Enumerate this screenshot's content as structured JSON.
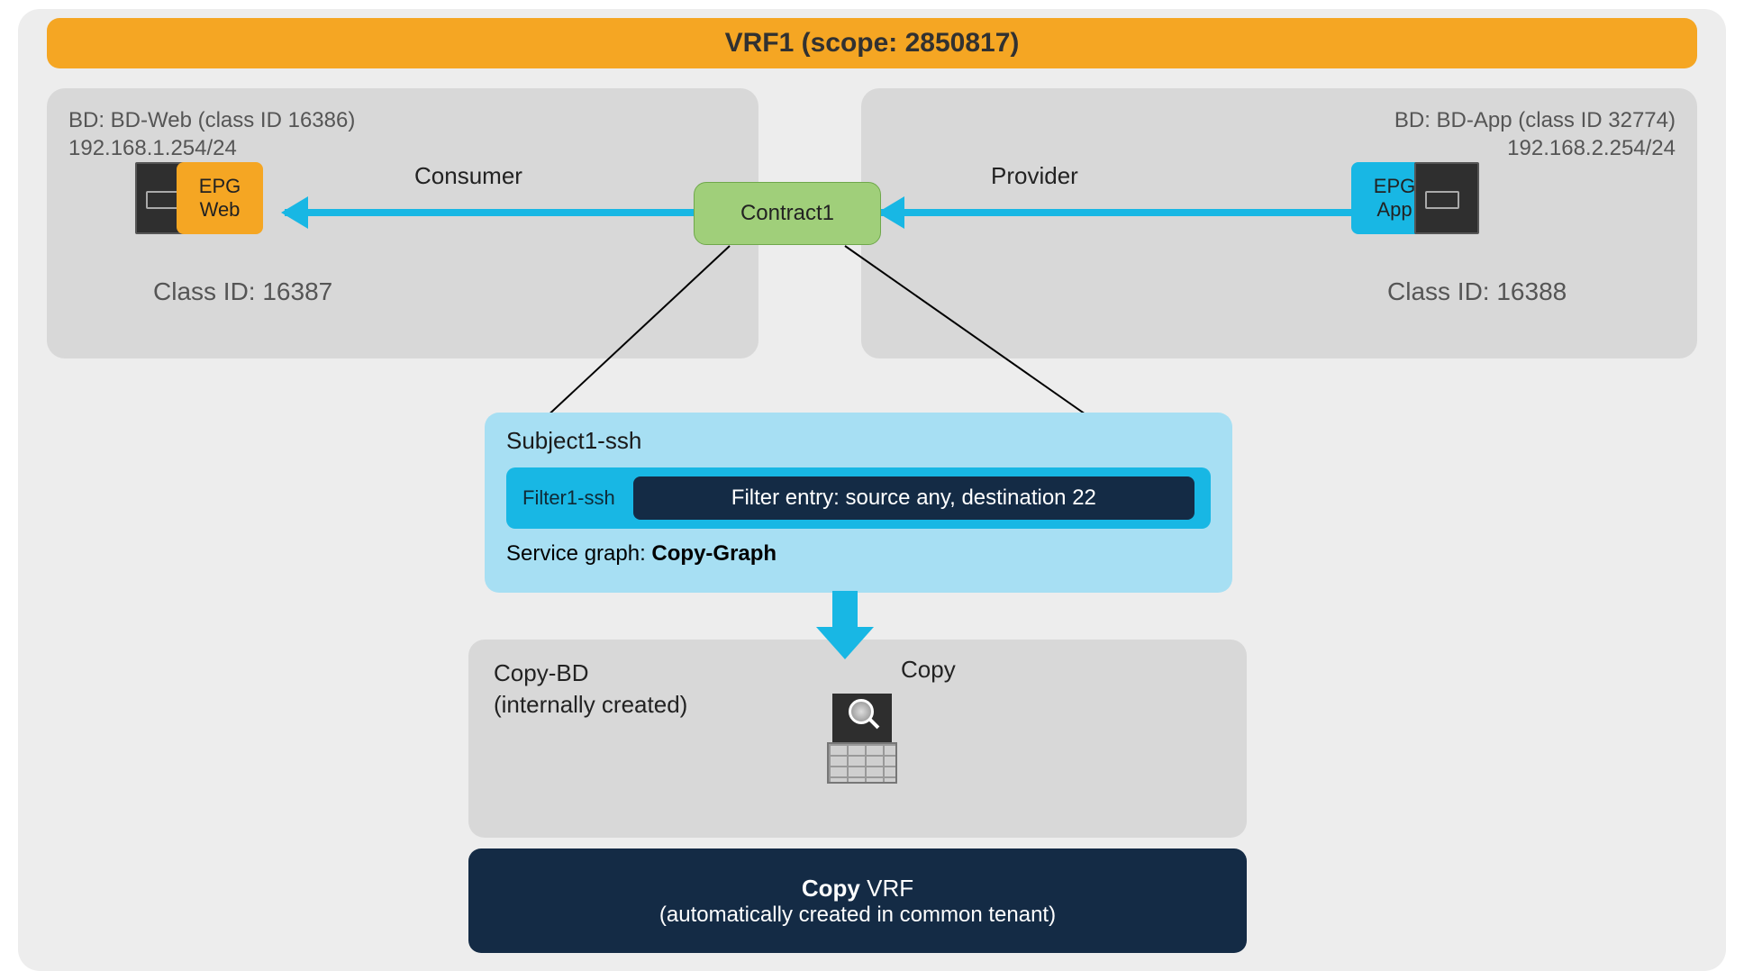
{
  "vrf_banner": "VRF1 (scope: 2850817)",
  "bd_web": {
    "title_l1": "BD: BD-Web (class ID 16386)",
    "title_l2": "192.168.1.254/24",
    "epg_l1": "EPG",
    "epg_l2": "Web",
    "class_id": "Class ID: 16387"
  },
  "bd_app": {
    "title_l1": "BD: BD-App (class ID 32774)",
    "title_l2": "192.168.2.254/24",
    "epg_l1": "EPG",
    "epg_l2": "App",
    "class_id": "Class ID: 16388"
  },
  "contract": "Contract1",
  "consumer_label": "Consumer",
  "provider_label": "Provider",
  "subject": {
    "title": "Subject1-ssh",
    "filter_name": "Filter1-ssh",
    "filter_entry": "Filter entry: source any, destination 22",
    "service_graph_label": "Service graph: ",
    "service_graph_value": "Copy-Graph"
  },
  "copy_bd": {
    "l1": "Copy-BD",
    "l2": "(internally created)",
    "copy_label": "Copy"
  },
  "copy_vrf": {
    "bold": "Copy",
    "rest": " VRF",
    "sub": "(automatically created in common tenant)"
  },
  "colors": {
    "orange": "#f5a623",
    "cyan": "#18b7e4",
    "light_cyan": "#a7dff3",
    "green": "#a0cf7a",
    "navy": "#142b45",
    "grey_bg": "#ededed",
    "grey_box": "#d8d8d8"
  }
}
